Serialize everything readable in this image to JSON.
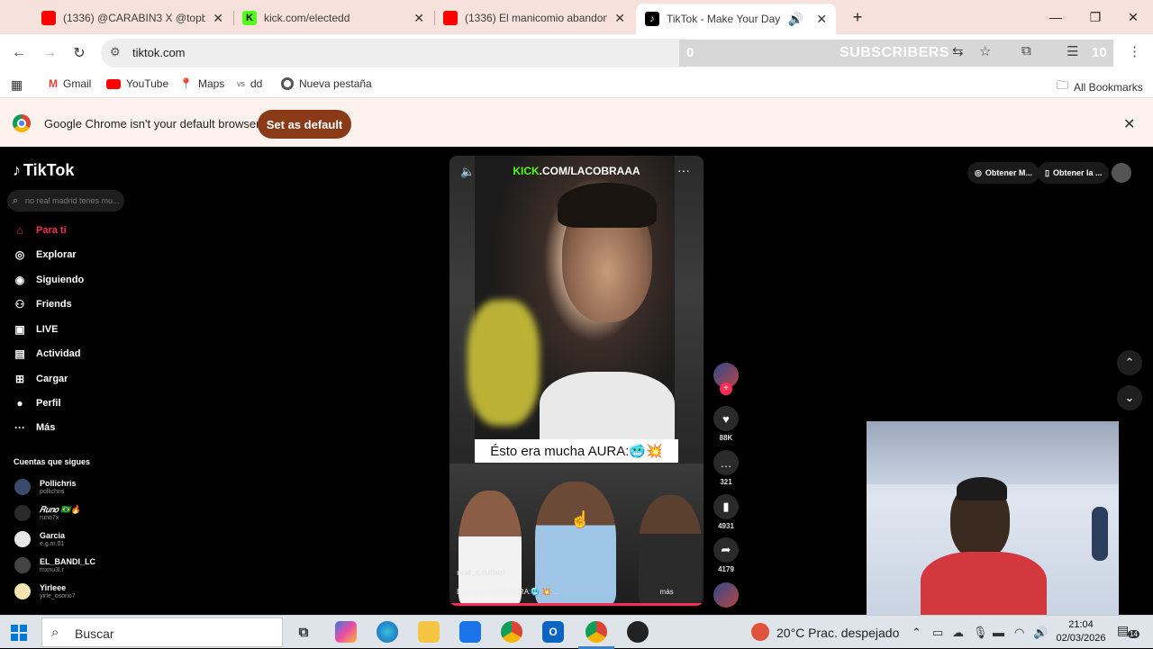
{
  "browser": {
    "tabs": [
      {
        "title": "(1336) @CARABIN3 X @topboy",
        "favicon": "youtube",
        "color": "#ff0000"
      },
      {
        "title": "kick.com/electedd",
        "favicon": "kick",
        "color": "#53fc18"
      },
      {
        "title": "(1336) El manicomio abandona",
        "favicon": "youtube",
        "color": "#ff0000"
      },
      {
        "title": "TikTok - Make Your Day",
        "favicon": "tiktok",
        "color": "#000000",
        "active": true
      }
    ],
    "new_tab": "+",
    "url": "tiktok.com",
    "overlay": {
      "left_count": "0",
      "label": "SUBSCRIBERS",
      "right_count": "10"
    },
    "bookmarks": [
      {
        "label": "Gmail",
        "icon": "gmail-icon"
      },
      {
        "label": "YouTube",
        "icon": "youtube-icon"
      },
      {
        "label": "Maps",
        "icon": "maps-icon"
      },
      {
        "label": "dd",
        "icon": "vs-icon",
        "prefix": "vs"
      },
      {
        "label": "Nueva pestaña",
        "icon": "chrome-icon"
      }
    ],
    "all_bookmarks": "All Bookmarks",
    "infobar": {
      "message": "Google Chrome isn't your default browser",
      "button": "Set as default"
    }
  },
  "tiktok": {
    "logo": "TikTok",
    "search_placeholder": "no real madrid tenes mu...",
    "nav": [
      {
        "label": "Para ti",
        "icon": "home-icon",
        "active": true
      },
      {
        "label": "Explorar",
        "icon": "compass-icon"
      },
      {
        "label": "Siguiendo",
        "icon": "following-icon"
      },
      {
        "label": "Friends",
        "icon": "friends-icon"
      },
      {
        "label": "LIVE",
        "icon": "live-icon"
      },
      {
        "label": "Actividad",
        "icon": "activity-icon"
      },
      {
        "label": "Cargar",
        "icon": "upload-icon"
      },
      {
        "label": "Perfil",
        "icon": "profile-icon"
      },
      {
        "label": "Más",
        "icon": "more-icon"
      }
    ],
    "following_title": "Cuentas que sigues",
    "following": [
      {
        "name": "Pollichris",
        "handle": "pollichris",
        "color": "#3a4a6b"
      },
      {
        "name": "𝑅𝑢𝑛𝑜 🇧🇷🔥",
        "handle": "runo7x",
        "color": "#2a2a2a"
      },
      {
        "name": "Garcia",
        "handle": "e.g.m.01",
        "color": "#e6e6e6"
      },
      {
        "name": "EL_BANDI_LC",
        "handle": "mxnu3l.r",
        "color": "#444444"
      },
      {
        "name": "Yirleee",
        "handle": "yirle_osorio7",
        "color": "#f4e4b0"
      }
    ],
    "video": {
      "banner_prefix": "KICK",
      "banner_rest": ".COM/LACOBRAAA",
      "caption": "Ésto era mucha AURA:🥶💥",
      "watermark": "real_c.futbol",
      "info": "Ésto era mucha AURA:🥶 💥 ...",
      "more_label": "más",
      "progress": 0.99
    },
    "actions": [
      {
        "icon": "heart-icon",
        "count": "88K"
      },
      {
        "icon": "comment-icon",
        "count": "321"
      },
      {
        "icon": "bookmark-icon",
        "count": "4931"
      },
      {
        "icon": "share-icon",
        "count": "4179"
      }
    ],
    "top_right": [
      {
        "label": "Obtener M...",
        "icon": "coin-icon"
      },
      {
        "label": "Obtener la ...",
        "icon": "phone-icon"
      }
    ]
  },
  "taskbar": {
    "search": "Buscar",
    "weather": "20°C  Prac. despejado",
    "time": "21:04",
    "date": "02/03/2026",
    "notifications": "14"
  }
}
